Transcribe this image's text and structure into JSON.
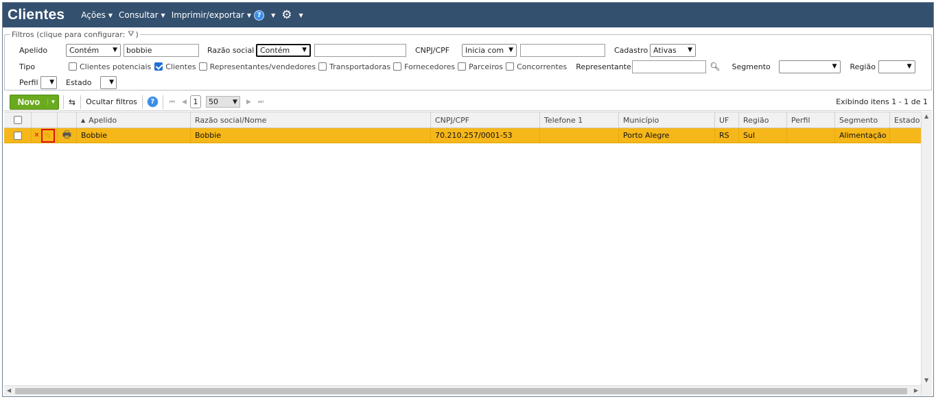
{
  "header": {
    "title": "Clientes",
    "menu": [
      "Ações",
      "Consultar",
      "Imprimir/exportar"
    ],
    "help_label": "?"
  },
  "filters": {
    "legend": "Filtros (clique para configurar:",
    "legend_close": ")",
    "apelido": {
      "label": "Apelido",
      "mode": "Contém",
      "value": "bobbie"
    },
    "razao_social": {
      "label": "Razão social",
      "mode": "Contém",
      "value": ""
    },
    "cnpj": {
      "label": "CNPJ/CPF",
      "mode": "Inicia com",
      "value": ""
    },
    "cadastro": {
      "label": "Cadastro",
      "value": "Ativas"
    },
    "tipo": {
      "label": "Tipo",
      "options": [
        {
          "label": "Clientes potenciais",
          "checked": false
        },
        {
          "label": "Clientes",
          "checked": true
        },
        {
          "label": "Representantes/vendedores",
          "checked": false
        },
        {
          "label": "Transportadoras",
          "checked": false
        },
        {
          "label": "Fornecedores",
          "checked": false
        },
        {
          "label": "Parceiros",
          "checked": false
        },
        {
          "label": "Concorrentes",
          "checked": false
        }
      ]
    },
    "representante": {
      "label": "Representante",
      "value": ""
    },
    "segmento": {
      "label": "Segmento",
      "value": ""
    },
    "regiao": {
      "label": "Região",
      "value": ""
    },
    "perfil": {
      "label": "Perfil",
      "value": ""
    },
    "estado": {
      "label": "Estado",
      "value": ""
    }
  },
  "toolbar": {
    "novo_label": "Novo",
    "hide_filters_label": "Ocultar filtros",
    "help_label": "?",
    "page": "1",
    "page_size": "50",
    "showing": "Exibindo itens 1 - 1 de 1"
  },
  "grid": {
    "columns": [
      "Apelido",
      "Razão social/Nome",
      "CNPJ/CPF",
      "Telefone 1",
      "Município",
      "UF",
      "Região",
      "Perfil",
      "Segmento",
      "Estado"
    ],
    "rows": [
      {
        "apelido": "Bobbie",
        "razao": "Bobbie",
        "cnpj": "70.210.257/0001-53",
        "telefone": "",
        "municipio": "Porto Alegre",
        "uf": "RS",
        "regiao": "Sul",
        "perfil": "",
        "segmento": "Alimentação",
        "estado": ""
      }
    ]
  },
  "colors": {
    "header_bg": "#34506f",
    "selected_row": "#f5b719",
    "novo_button": "#6aaa1e"
  }
}
